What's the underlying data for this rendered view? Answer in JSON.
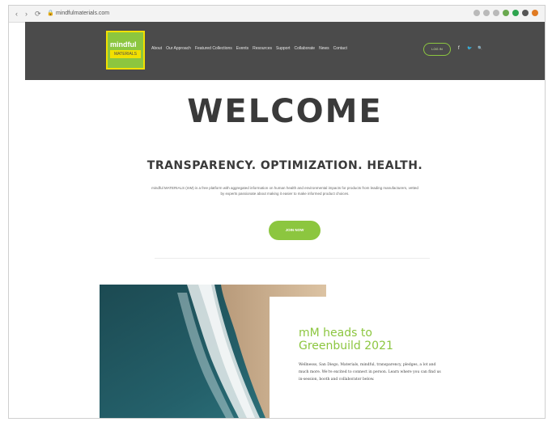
{
  "browser": {
    "url": "mindfulmaterials.com",
    "nav_glyphs": [
      "‹",
      "›",
      "⟳"
    ]
  },
  "header": {
    "logo_top": "mindful",
    "logo_bottom": "MATERIALS",
    "menu": [
      "About",
      "Our Approach",
      "Featured Collections",
      "Events",
      "Resources",
      "Support",
      "Collaborate",
      "News",
      "Contact"
    ],
    "login_label": "LOG IN",
    "social": [
      "f",
      "🐦",
      "🔍"
    ]
  },
  "main": {
    "title": "WELCOME",
    "tagline": "TRANSPARENCY. OPTIMIZATION. HEALTH.",
    "description": "mindful MATERIALS (mM) is a free platform with aggregated information on human health and environmental impacts for products from leading manufacturers, vetted by experts passionate about making it easier to make informed product choices.",
    "cta_label": "JOIN NOW"
  },
  "article": {
    "title": "mM heads to Greenbuild 2021",
    "body": "Wellnesss, San Diego, Materials, mindful, transparency, pledges, a lot and much more. We're excited to connect in person. Learn where you can find us in-session, booth and collaborator below."
  },
  "colors": {
    "accent": "#8cc63f",
    "header_bg": "#4b4b4b",
    "logo_yellow": "#f2e000"
  }
}
